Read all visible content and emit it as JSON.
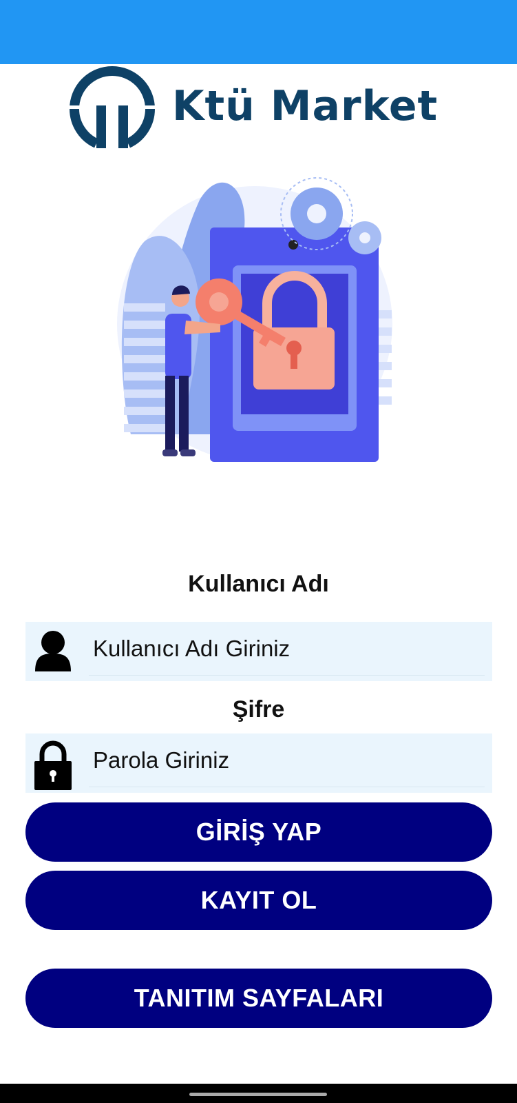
{
  "app": {
    "brand": "Ktü Market"
  },
  "colors": {
    "status_bar": "#2196f3",
    "button": "#000080",
    "brand": "#0e4166",
    "field_bg": "#eaf5fd"
  },
  "login": {
    "username_label": "Kullanıcı Adı",
    "username_placeholder": "Kullanıcı Adı Giriniz",
    "username_icon": "user-icon",
    "password_label": "Şifre",
    "password_placeholder": "Parola Giriniz",
    "password_icon": "lock-icon"
  },
  "buttons": {
    "login": "GİRİŞ YAP",
    "register": "KAYIT OL",
    "intro": "TANITIM SAYFALARI"
  }
}
